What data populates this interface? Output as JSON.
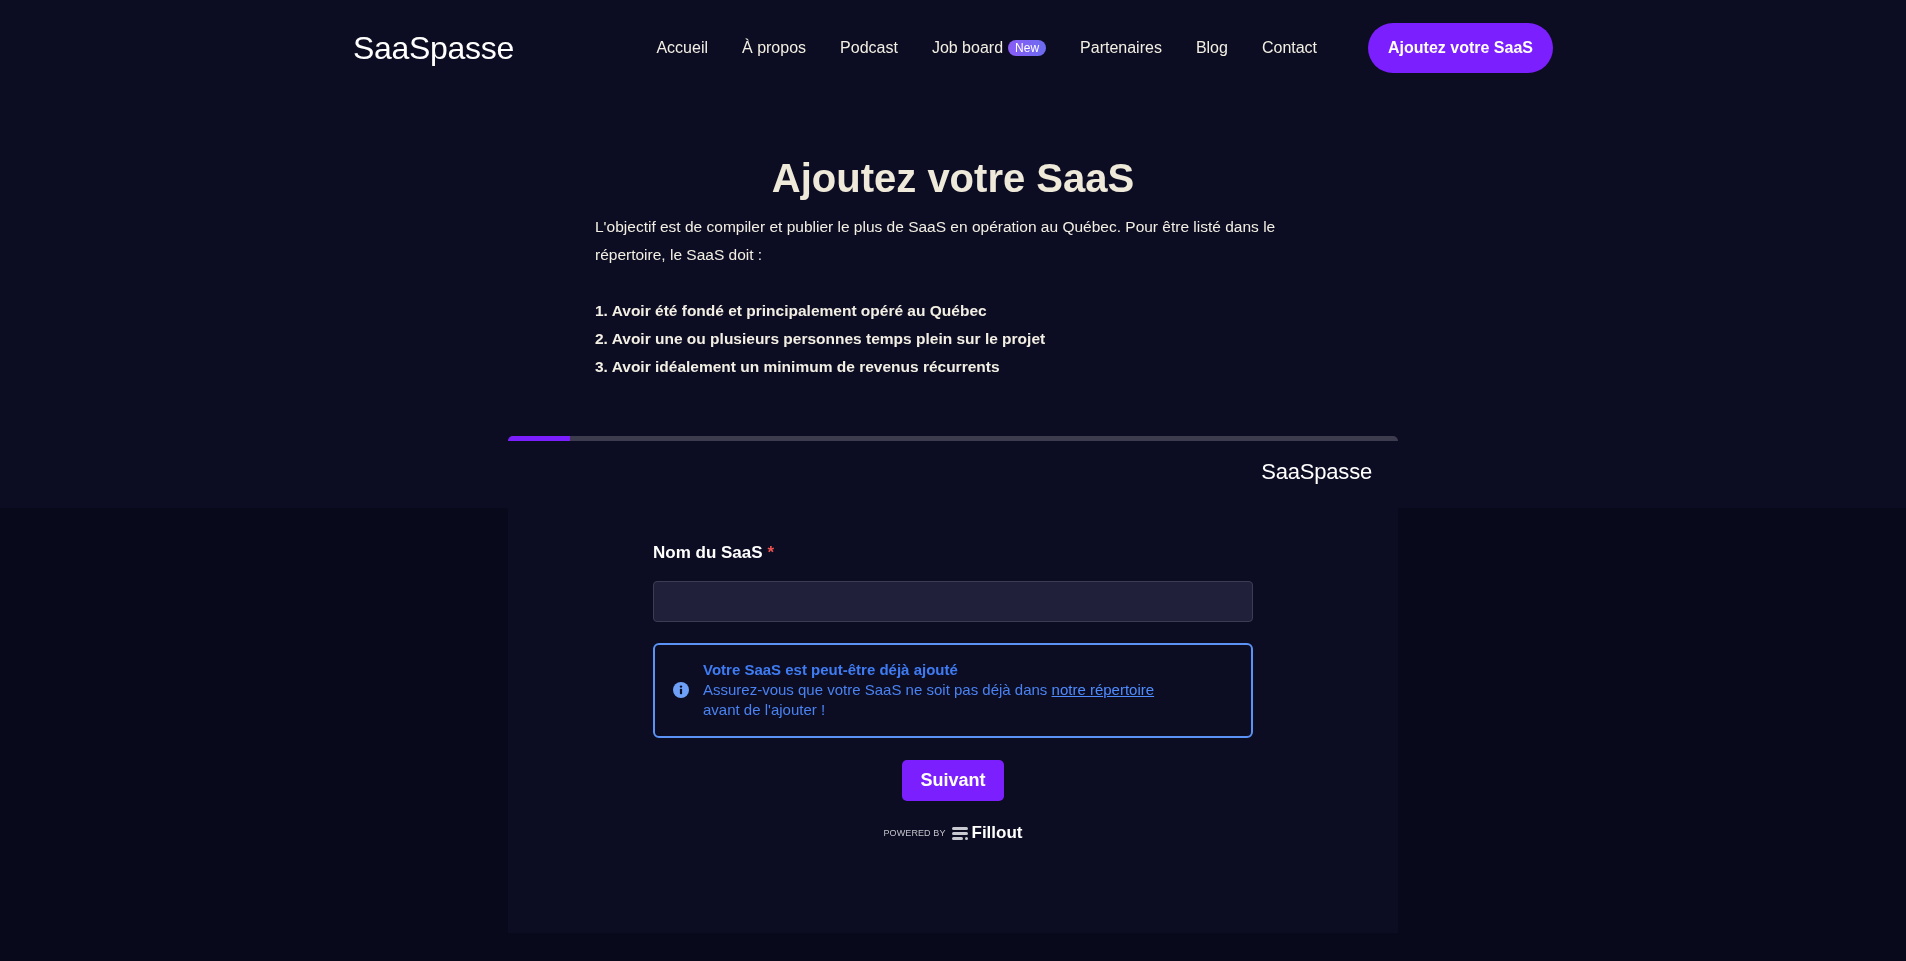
{
  "header": {
    "logo": "SaaSpasse",
    "nav": [
      {
        "label": "Accueil"
      },
      {
        "label": "À propos"
      },
      {
        "label": "Podcast"
      },
      {
        "label": "Job board",
        "badge": "New"
      },
      {
        "label": "Partenaires"
      },
      {
        "label": "Blog"
      },
      {
        "label": "Contact"
      }
    ],
    "cta": "Ajoutez votre SaaS"
  },
  "intro": {
    "title": "Ajoutez votre SaaS",
    "paragraph": "L'objectif est de compiler et publier le plus de SaaS en opération au Québec. Pour être listé dans le répertoire, le SaaS doit :",
    "requirements": [
      "1. Avoir été fondé et principalement opéré au Québec",
      "2. Avoir une ou plusieurs personnes temps plein sur le projet",
      "3. Avoir idéalement un minimum de revenus récurrents"
    ]
  },
  "form": {
    "progress": {
      "level": 0.07
    },
    "logo": "SaaSpasse",
    "field": {
      "label": "Nom du SaaS",
      "required_mark": "*"
    },
    "notice": {
      "title": "Votre SaaS est peut-être déjà ajouté",
      "text_before": "Assurez-vous que votre SaaS ne soit pas déjà dans ",
      "link": "notre répertoire",
      "text_after": " avant de l'ajouter !"
    },
    "submit": "Suivant",
    "powered_by": {
      "prefix": "POWERED BY",
      "brand": "Fillout"
    }
  }
}
